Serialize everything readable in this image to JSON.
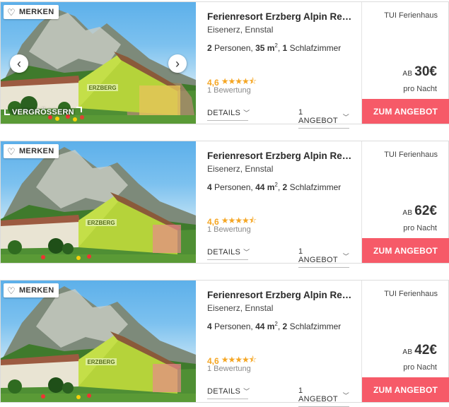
{
  "listings": [
    {
      "merken_label": "MERKEN",
      "zoom_label": "VERGRÖSSERN",
      "title": "Ferienresort Erzberg Alpin Res...",
      "location": "Eisenerz, Ennstal",
      "persons": "2",
      "persons_label": " Personen, ",
      "area": "35 m",
      "area_sup": "2",
      "rooms_sep": ", ",
      "rooms": "1",
      "rooms_label": " Schlafzimmer",
      "rating": "4,6",
      "stars": 4.5,
      "reviews": "1 Bewertung",
      "details_label": "DETAILS",
      "offers_label": "1 ANGEBOT",
      "provider": "TUI Ferienhaus",
      "ab_label": "AB",
      "price": "30€",
      "per_night": "pro Nacht",
      "cta_label": "ZUM ANGEBOT"
    },
    {
      "merken_label": "MERKEN",
      "title": "Ferienresort Erzberg Alpin Res...",
      "location": "Eisenerz, Ennstal",
      "persons": "4",
      "persons_label": " Personen, ",
      "area": "44 m",
      "area_sup": "2",
      "rooms_sep": ", ",
      "rooms": "2",
      "rooms_label": " Schlafzimmer",
      "rating": "4,6",
      "stars": 4.5,
      "reviews": "1 Bewertung",
      "details_label": "DETAILS",
      "offers_label": "1 ANGEBOT",
      "provider": "TUI Ferienhaus",
      "ab_label": "AB",
      "price": "62€",
      "per_night": "pro Nacht",
      "cta_label": "ZUM ANGEBOT"
    },
    {
      "merken_label": "MERKEN",
      "title": "Ferienresort Erzberg Alpin Res...",
      "location": "Eisenerz, Ennstal",
      "persons": "4",
      "persons_label": " Personen, ",
      "area": "44 m",
      "area_sup": "2",
      "rooms_sep": ", ",
      "rooms": "2",
      "rooms_label": " Schlafzimmer",
      "rating": "4,6",
      "stars": 4.5,
      "reviews": "1 Bewertung",
      "details_label": "DETAILS",
      "offers_label": "1 ANGEBOT",
      "provider": "TUI Ferienhaus",
      "ab_label": "AB",
      "price": "42€",
      "per_night": "pro Nacht",
      "cta_label": "ZUM ANGEBOT"
    }
  ],
  "icons": {
    "heart": "heart-icon",
    "prev": "chevron-left-icon",
    "next": "chevron-right-icon",
    "zoom": "expand-icon",
    "chevron_down": "chevron-down-icon",
    "star": "star-icon"
  },
  "building_sign": "ERZBERG",
  "colors": {
    "cta": "#f65a68",
    "rating": "#f5a623",
    "building": "#b5d33a"
  }
}
